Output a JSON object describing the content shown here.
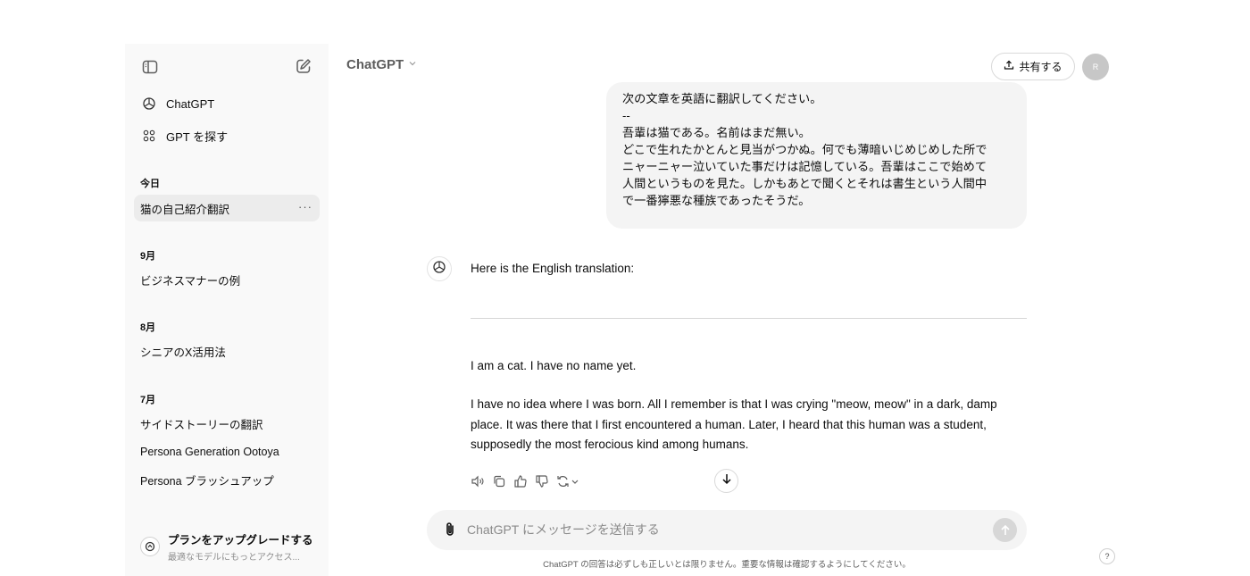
{
  "sidebar": {
    "toggle_icon": "sidebar-toggle-icon",
    "new_chat_icon": "new-chat-icon",
    "nav": [
      {
        "label": "ChatGPT",
        "icon": "openai-icon"
      },
      {
        "label": "GPT を探す",
        "icon": "grid-icon"
      }
    ],
    "groups": [
      {
        "title": "今日",
        "items": [
          {
            "label": "猫の自己紹介翻訳",
            "active": true
          }
        ]
      },
      {
        "title": "9月",
        "items": [
          {
            "label": "ビジネスマナーの例"
          }
        ]
      },
      {
        "title": "8月",
        "items": [
          {
            "label": "シニアのX活用法"
          }
        ]
      },
      {
        "title": "7月",
        "items": [
          {
            "label": "サイドストーリーの翻訳"
          },
          {
            "label": "Persona Generation Ootoya"
          },
          {
            "label": "Persona ブラッシュアップ"
          }
        ]
      }
    ],
    "item_more": "···",
    "upgrade": {
      "title": "プランをアップグレードする",
      "subtitle": "最適なモデルにもっとアクセス..."
    }
  },
  "header": {
    "model": "ChatGPT",
    "share_label": "共有する",
    "avatar_initial": "R"
  },
  "conversation": {
    "user_message": "次の文章を英語に翻訳してください。\n--\n吾輩は猫である。名前はまだ無い。\nどこで生れたかとんと見当がつかぬ。何でも薄暗いじめじめした所で\nニャーニャー泣いていた事だけは記憶している。吾輩はここで始めて\n人間というものを見た。しかもあとで聞くとそれは書生という人間中\nで一番獰悪な種族であったそうだ。",
    "assistant": {
      "intro": "Here is the English translation:",
      "p1": "I am a cat. I have no name yet.",
      "p2": "I have no idea where I was born. All I remember is that I was crying \"meow, meow\" in a dark, damp place. It was there that I first encountered a human. Later, I heard that this human was a student, supposedly the most ferocious kind among humans."
    }
  },
  "composer": {
    "placeholder": "ChatGPT にメッセージを送信する",
    "disclaimer": "ChatGPT の回答は必ずしも正しいとは限りません。重要な情報は確認するようにしてください。"
  },
  "help_label": "?",
  "colors": {
    "sidebar_bg": "#f9f9f9",
    "bubble_bg": "#f4f4f4",
    "active_item": "#ececec"
  }
}
